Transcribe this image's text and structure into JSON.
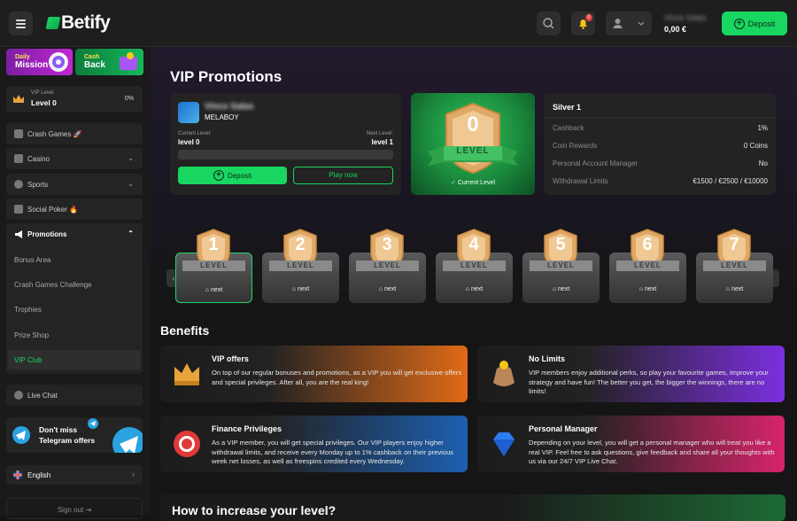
{
  "header": {
    "brand": "Betify",
    "user_name": "Vince Salas",
    "balance": "0,00 €",
    "deposit_label": "Deposit",
    "notification_count": "0"
  },
  "sidebar": {
    "daily_mission": {
      "line1": "Daily",
      "line2": "Mission"
    },
    "cash_back": {
      "line1": "Cash",
      "line2": "Back"
    },
    "vip_level": {
      "label": "VIP Level",
      "value": "Level 0",
      "percent": "0%"
    },
    "nav": [
      {
        "label": "Crash Games",
        "emoji": "🚀"
      },
      {
        "label": "Casino"
      },
      {
        "label": "Sports"
      },
      {
        "label": "Social Poker",
        "emoji": "🔥"
      },
      {
        "label": "Promotions"
      }
    ],
    "promotions_sub": [
      "Bonus Area",
      "Crash Games Challenge",
      "Trophies",
      "Prize Shop",
      "VIP Club"
    ],
    "live_chat": "Live Chat",
    "telegram": {
      "line1": "Don't miss",
      "line2": "Telegram offers"
    },
    "language": "English",
    "sign_out": "Sign out"
  },
  "main": {
    "title": "VIP Promotions",
    "profile": {
      "username": "Vince Salas",
      "nickname": "MELABOY",
      "current_label": "Current Level:",
      "current_value": "level 0",
      "next_label": "Next Level:",
      "next_value": "level 1",
      "deposit_label": "Deposit",
      "play_label": "Play now"
    },
    "current_level": {
      "number": "0",
      "ribbon": "LEVEL",
      "caption": "Current Level"
    },
    "info": {
      "title": "Silver 1",
      "rows": [
        {
          "label": "Cashback",
          "value": "1%"
        },
        {
          "label": "Coin Rewards",
          "value": "0 Coins"
        },
        {
          "label": "Personal Account Manager",
          "value": "No"
        },
        {
          "label": "Withdrawal Limits",
          "value": "€1500 / €2500 / €10000"
        }
      ]
    },
    "levels": [
      {
        "number": "1",
        "ribbon": "LEVEL",
        "caption": "next"
      },
      {
        "number": "2",
        "ribbon": "LEVEL",
        "caption": "next"
      },
      {
        "number": "3",
        "ribbon": "LEVEL",
        "caption": "next"
      },
      {
        "number": "4",
        "ribbon": "LEVEL",
        "caption": "next"
      },
      {
        "number": "5",
        "ribbon": "LEVEL",
        "caption": "next"
      },
      {
        "number": "6",
        "ribbon": "LEVEL",
        "caption": "next"
      },
      {
        "number": "7",
        "ribbon": "LEVEL",
        "caption": "next"
      }
    ],
    "benefits_title": "Benefits",
    "benefits": [
      {
        "title": "VIP offers",
        "text": "On top of our regular bonuses and promotions, as a VIP you will get exclusive offers and special privileges. After all, you are the real king!"
      },
      {
        "title": "No Limits",
        "text": "VIP members enjoy additional perks, so play your favourite games, improve your strategy and have fun! The better you get, the bigger the winnings, there are no limits!"
      },
      {
        "title": "Finance Privileges",
        "text": "As a VIP member, you will get special privileges. Our VIP players enjoy higher withdrawal limits, and receive every Monday up to 1% cashback on their previous week net losses, as well as freespins credited every Wednesday."
      },
      {
        "title": "Personal Manager",
        "text": "Depending on your level, you will get a personal manager who will treat you like a real VIP. Feel free to ask questions, give feedback and share all your thoughts with us via our 24/7 VIP Live Chat."
      }
    ],
    "increase_title": "How to increase your level?"
  },
  "colors": {
    "accent": "#19d660",
    "page_bg": "#151515",
    "card_bg": "#232323"
  }
}
